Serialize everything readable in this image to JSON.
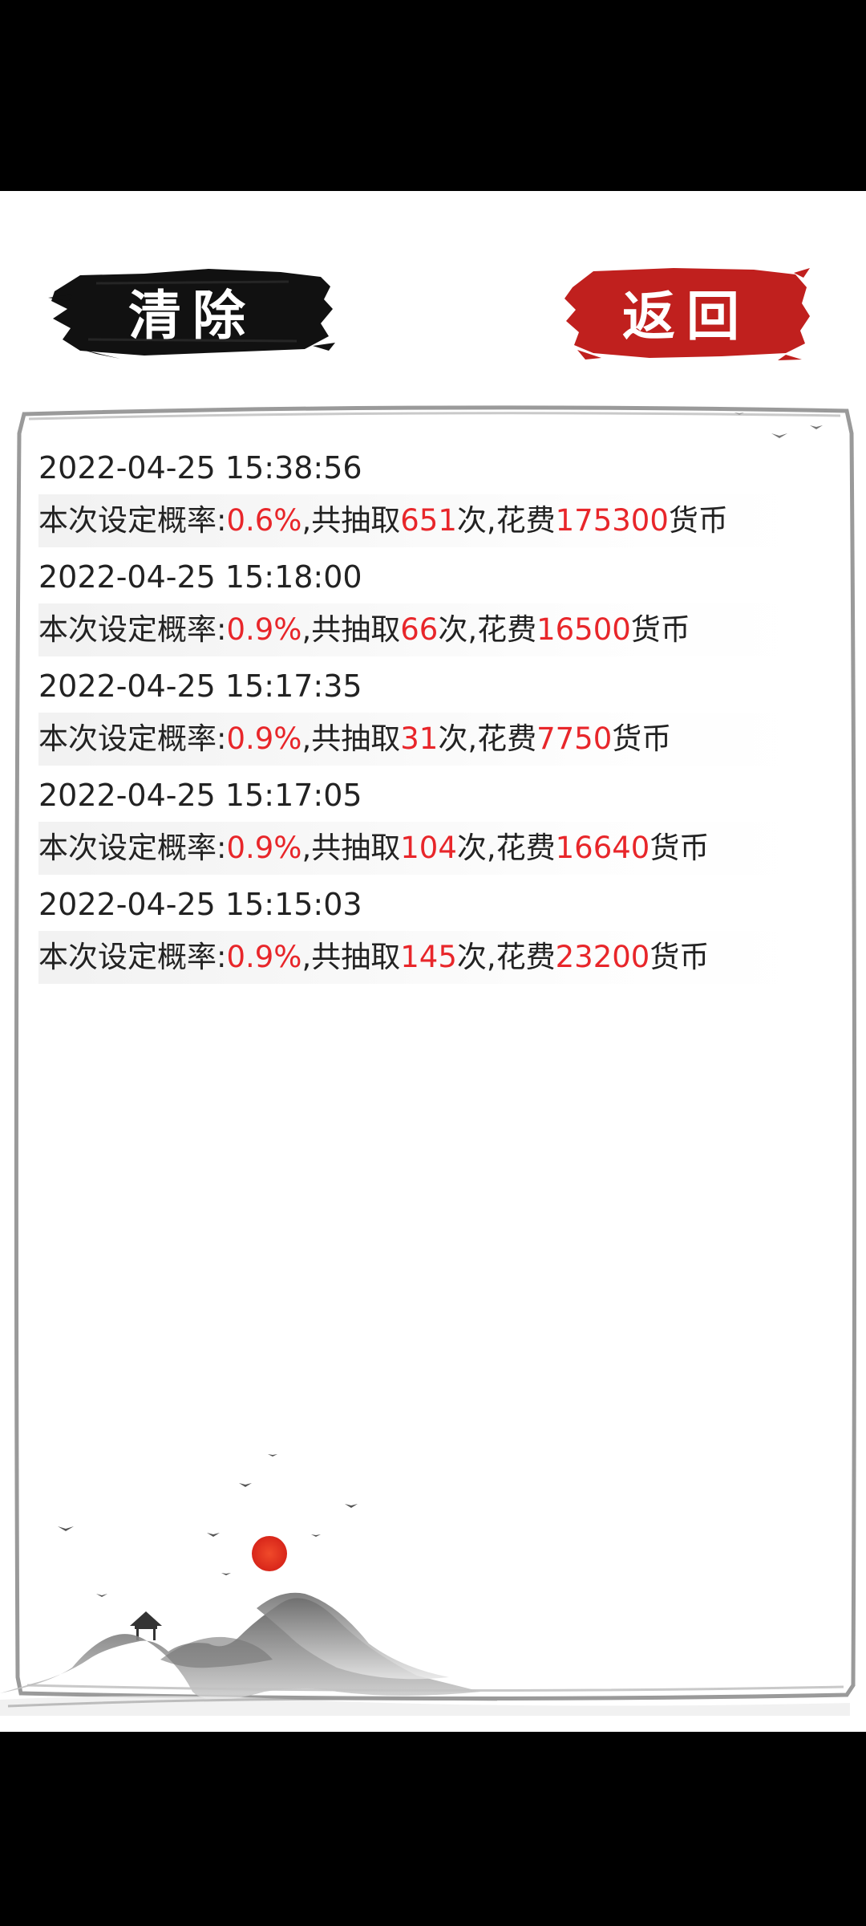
{
  "buttons": {
    "clear_label": "清除",
    "back_label": "返回"
  },
  "record_text": {
    "prob_prefix": "本次设定概率:",
    "draw_prefix": ",共抽取",
    "draw_suffix": "次,花费",
    "cost_suffix": "货币"
  },
  "records": [
    {
      "time": "2022-04-25 15:38:56",
      "probability": "0.6%",
      "draws": "651",
      "cost": "175300"
    },
    {
      "time": "2022-04-25 15:18:00",
      "probability": "0.9%",
      "draws": "66",
      "cost": "16500"
    },
    {
      "time": "2022-04-25 15:17:35",
      "probability": "0.9%",
      "draws": "31",
      "cost": "7750"
    },
    {
      "time": "2022-04-25 15:17:05",
      "probability": "0.9%",
      "draws": "104",
      "cost": "16640"
    },
    {
      "time": "2022-04-25 15:15:03",
      "probability": "0.9%",
      "draws": "145",
      "cost": "23200"
    }
  ],
  "colors": {
    "highlight": "#e8262a",
    "back_button": "#c0201e",
    "clear_button": "#111111",
    "sun": "#e8321f"
  }
}
